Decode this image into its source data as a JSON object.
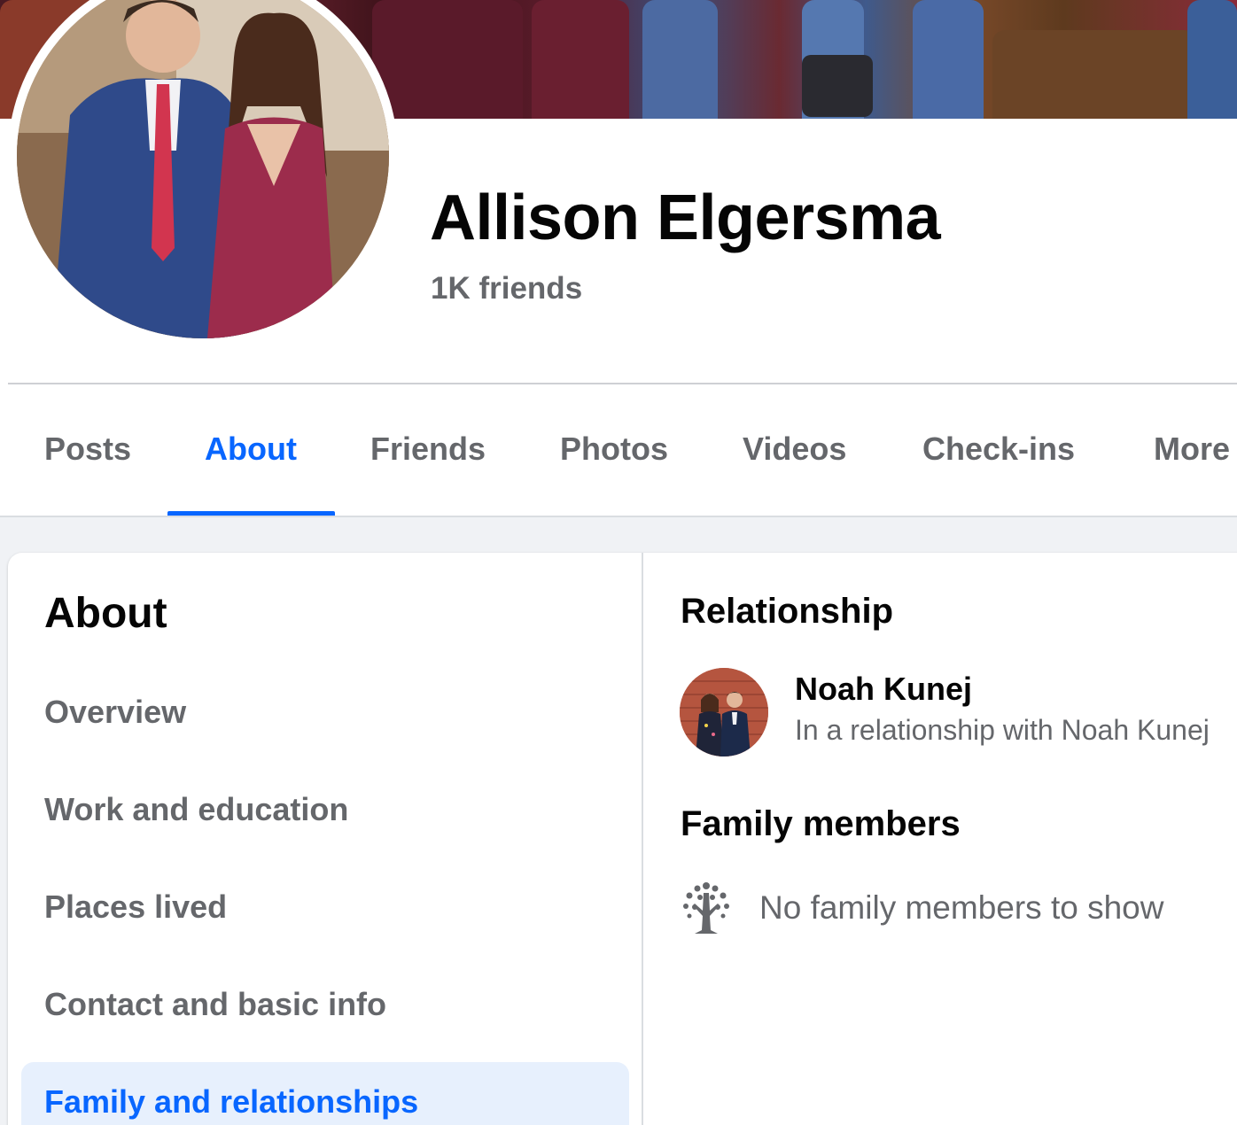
{
  "profile": {
    "name": "Allison Elgersma",
    "friends_count": "1K friends"
  },
  "tabs": [
    {
      "label": "Posts",
      "active": false
    },
    {
      "label": "About",
      "active": true
    },
    {
      "label": "Friends",
      "active": false
    },
    {
      "label": "Photos",
      "active": false
    },
    {
      "label": "Videos",
      "active": false
    },
    {
      "label": "Check-ins",
      "active": false
    },
    {
      "label": "More",
      "active": false
    }
  ],
  "about": {
    "title": "About",
    "items": [
      {
        "label": "Overview"
      },
      {
        "label": "Work and education"
      },
      {
        "label": "Places lived"
      },
      {
        "label": "Contact and basic info"
      },
      {
        "label": "Family and relationships",
        "active": true
      }
    ]
  },
  "relationship": {
    "title": "Relationship",
    "person_name": "Noah Kunej",
    "status": "In a relationship with Noah Kunej"
  },
  "family": {
    "title": "Family members",
    "empty_text": "No family members to show",
    "icon": "family-tree-icon"
  },
  "colors": {
    "accent": "#0866ff",
    "secondary_text": "#65676b",
    "active_bg": "#e7f0fd",
    "page_bg": "#f0f2f5"
  }
}
